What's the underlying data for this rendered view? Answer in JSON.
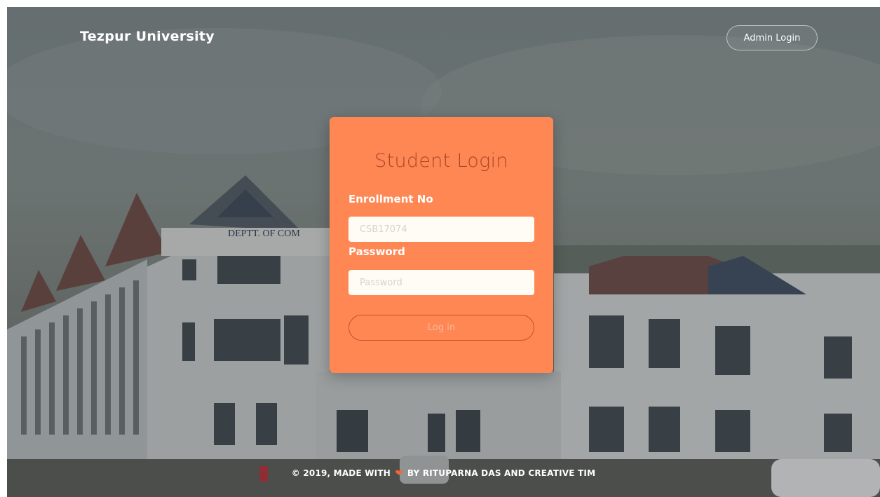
{
  "navbar": {
    "brand": "Tezpur University",
    "admin_login_label": "Admin Login"
  },
  "login_card": {
    "title": "Student Login",
    "enrollment_label": "Enrollment No",
    "enrollment_placeholder": "CSB17074",
    "password_label": "Password",
    "password_placeholder": "Password",
    "submit_label": "Log in"
  },
  "footer": {
    "prefix": "© 2019, MADE WITH",
    "heart_icon": "heart-icon",
    "suffix": "BY RITUPARNA DAS AND CREATIVE TIM"
  },
  "background": {
    "building_sign": "DEPTT. OF COM"
  },
  "colors": {
    "card": "#ff8754",
    "card_title": "#a8482a",
    "heart": "#f96332"
  }
}
